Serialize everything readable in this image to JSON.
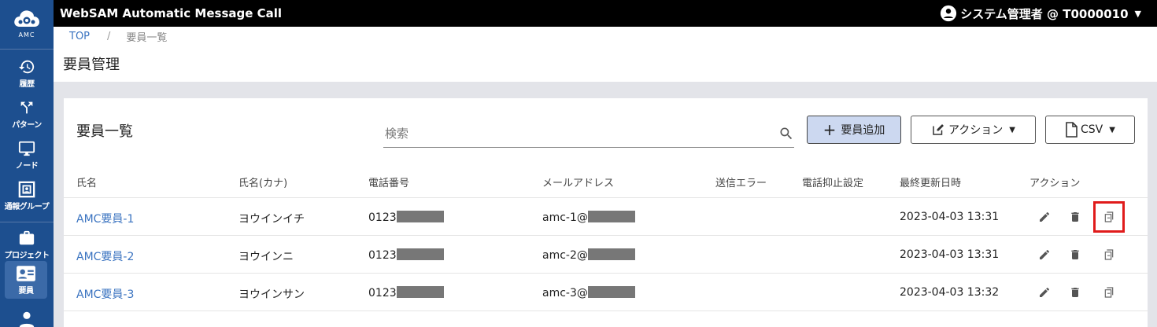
{
  "app": {
    "logo_text": "AMC",
    "title": "WebSAM Automatic Message Call",
    "user_label": "システム管理者 @ T0000010"
  },
  "sidebar": {
    "items": [
      {
        "label": "履歴",
        "icon": "history-icon"
      },
      {
        "label": "パターン",
        "icon": "pattern-icon"
      },
      {
        "label": "ノード",
        "icon": "monitor-icon"
      },
      {
        "label": "通報グループ",
        "icon": "group-icon"
      },
      {
        "label": "プロジェクト",
        "icon": "briefcase-icon"
      },
      {
        "label": "要員",
        "icon": "contact-card-icon",
        "active": true
      },
      {
        "label": "",
        "icon": "person-icon"
      }
    ]
  },
  "breadcrumb": {
    "top": "TOP",
    "separator": "/",
    "current": "要員一覧"
  },
  "page": {
    "title": "要員管理"
  },
  "card": {
    "title": "要員一覧",
    "search_placeholder": "検索",
    "add_button": "要員追加",
    "action_button": "アクション",
    "csv_button": "CSV"
  },
  "table": {
    "columns": [
      "氏名",
      "氏名(カナ)",
      "電話番号",
      "メールアドレス",
      "送信エラー",
      "電話抑止設定",
      "最終更新日時",
      "アクション"
    ],
    "rows": [
      {
        "name": "AMC要員-1",
        "kana": "ヨウインイチ",
        "phone": "0123",
        "email": "amc-1@",
        "send_error": "",
        "suppress": "",
        "updated": "2023-04-03 13:31"
      },
      {
        "name": "AMC要員-2",
        "kana": "ヨウインニ",
        "phone": "0123",
        "email": "amc-2@",
        "send_error": "",
        "suppress": "",
        "updated": "2023-04-03 13:31"
      },
      {
        "name": "AMC要員-3",
        "kana": "ヨウインサン",
        "phone": "0123",
        "email": "amc-3@",
        "send_error": "",
        "suppress": "",
        "updated": "2023-04-03 13:32"
      }
    ]
  },
  "colors": {
    "sidebar_bg": "#1d4f8f",
    "topbar_bg": "#000000",
    "link": "#3a73c0",
    "primary_button_bg": "#ccd8f0",
    "highlight": "#e01b1b"
  }
}
